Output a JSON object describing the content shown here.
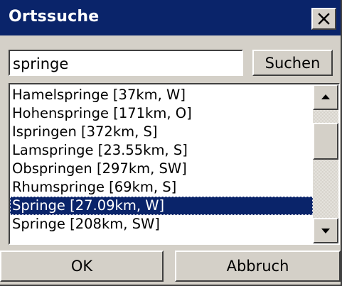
{
  "window": {
    "title": "Ortssuche",
    "close_icon": "close-icon"
  },
  "search": {
    "value": "springe",
    "button_label": "Suchen"
  },
  "results": {
    "items": [
      "Hamelspringe [37km, W]",
      "Hohenspringe [171km, O]",
      "Ispringen [372km, S]",
      "Lamspringe [23.55km, S]",
      "Obspringen [297km, SW]",
      "Rhumspringe [69km, S]",
      "Springe [27.09km, W]",
      "Springe [208km, SW]"
    ],
    "selected_index": 6,
    "scrollbar": {
      "up_icon": "scroll-up-arrow-icon",
      "down_icon": "scroll-down-arrow-icon"
    }
  },
  "footer": {
    "ok_label": "OK",
    "cancel_label": "Abbruch"
  },
  "colors": {
    "titlebar": "#0a246a",
    "selection": "#0a246a",
    "face": "#d4d0c8"
  }
}
